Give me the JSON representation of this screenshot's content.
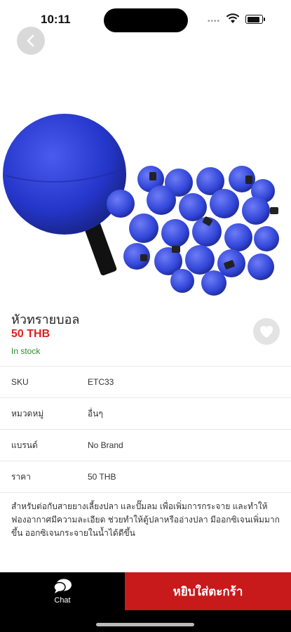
{
  "status_bar": {
    "time": "10:11"
  },
  "product": {
    "name": "หัวทรายบอล",
    "price": "50 THB",
    "stock_status": "In stock",
    "description": "สำหรับต่อกับสายยางเลี้ยงปลา และปั๊มลม เพื่อเพิ่มการกระจาย และทำให้ฟองอากาศมีความละเอียด ช่วยทำให้ตู้ปลาหรืออ่างปลา มีออกซิเจนเพิ่มมากขึ้น ออกซิเจนกระจายในน้ำได้ดีขึ้น",
    "image_icon": "blue-air-stone-ball-image"
  },
  "specs": [
    {
      "label": "SKU",
      "value": "ETC33"
    },
    {
      "label": "หมวดหมู่",
      "value": "อื่นๆ"
    },
    {
      "label": "แบรนด์",
      "value": "No Brand"
    },
    {
      "label": "ราคา",
      "value": "50  THB"
    }
  ],
  "bottom_bar": {
    "chat_label": "Chat",
    "add_to_cart_label": "หยิบใส่ตะกร้า"
  },
  "colors": {
    "price": "#e01f1f",
    "in_stock": "#2e8b2e",
    "cart_button": "#c8191b",
    "bottom_bar": "#000000",
    "product_blue": "#2d3fd6"
  }
}
